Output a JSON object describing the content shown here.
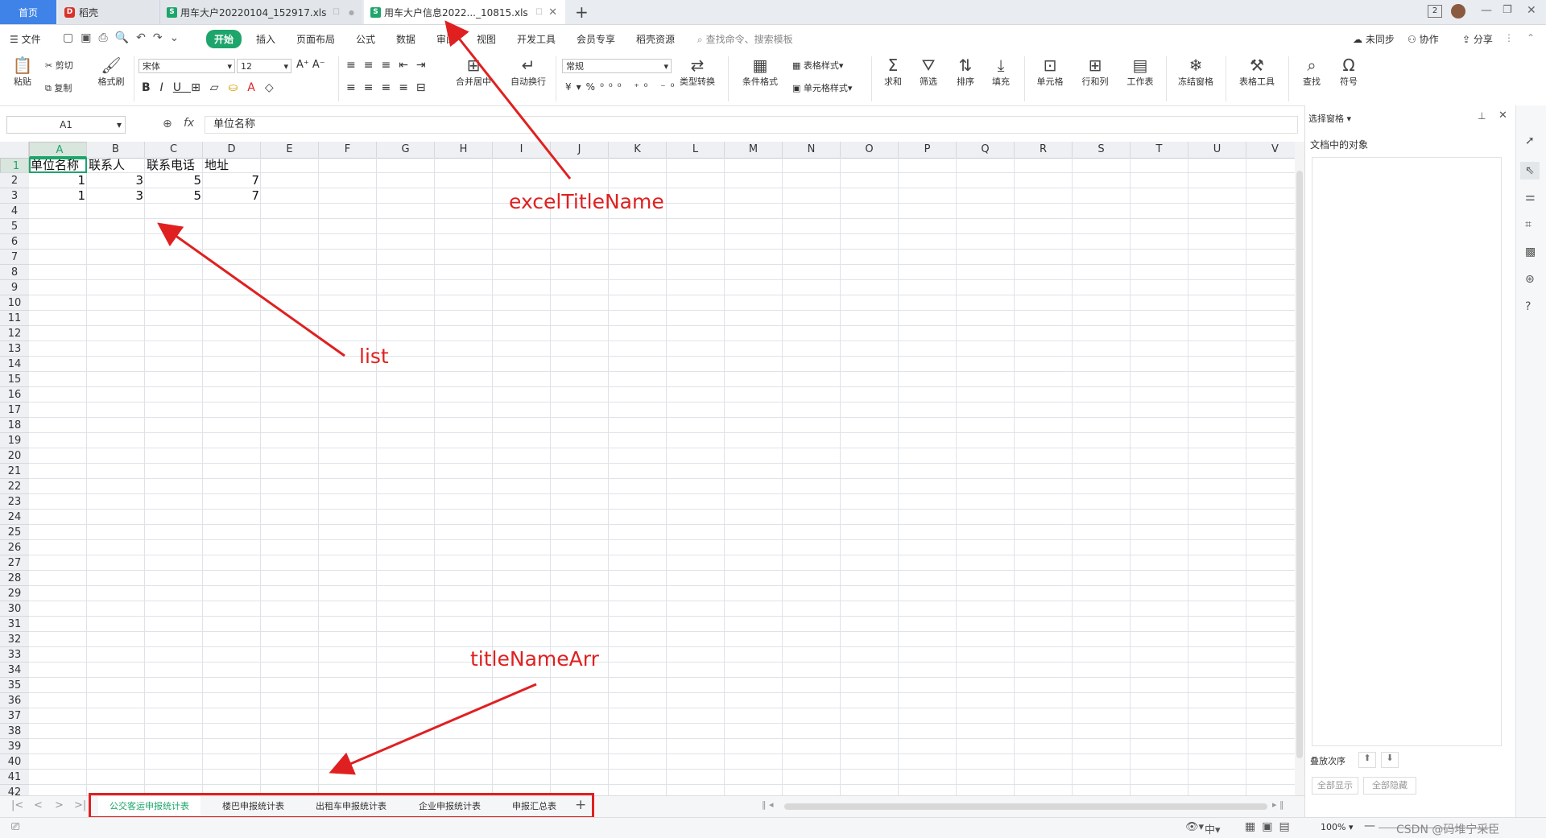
{
  "titlebar": {
    "home_tab": "首页",
    "tabs": [
      {
        "label": "稻壳",
        "icon": "docer-icon"
      },
      {
        "label": "用车大户20220104_152917.xls",
        "icon": "spreadsheet-icon"
      },
      {
        "label": "用车大户信息2022..._10815.xls",
        "icon": "spreadsheet-icon"
      }
    ],
    "new_tab": "+",
    "badge": "2"
  },
  "menubar": {
    "file": "文件",
    "items": [
      "开始",
      "插入",
      "页面布局",
      "公式",
      "数据",
      "审阅",
      "视图",
      "开发工具",
      "会员专享",
      "稻壳资源"
    ],
    "search_placeholder": "查找命令、搜索模板",
    "right": [
      "未同步",
      "协作",
      "分享"
    ]
  },
  "ribbon": {
    "paste": "粘贴",
    "cut": "剪切",
    "copy": "复制",
    "format_painter": "格式刷",
    "font_name": "宋体",
    "font_size": "12",
    "merge": "合并居中",
    "wrap": "自动换行",
    "number_format": "常规",
    "type_convert": "类型转换",
    "conditional": "条件格式",
    "table_style": "表格样式",
    "cell_style": "单元格样式",
    "sum": "求和",
    "filter": "筛选",
    "sort": "排序",
    "fill": "填充",
    "cell": "单元格",
    "rowcol": "行和列",
    "sheet": "工作表",
    "freeze": "冻结窗格",
    "table_tools": "表格工具",
    "find": "查找",
    "symbol": "符号",
    "currency": "¥",
    "percent": "%"
  },
  "formula": {
    "cell_ref": "A1",
    "fx": "fx",
    "value": "单位名称"
  },
  "grid": {
    "columns": [
      "A",
      "B",
      "C",
      "D",
      "E",
      "F",
      "G",
      "H",
      "I",
      "J",
      "K",
      "L",
      "M",
      "N",
      "O",
      "P",
      "Q",
      "R",
      "S",
      "T",
      "U",
      "V"
    ],
    "rows": [
      "1",
      "2",
      "3",
      "4",
      "5",
      "6",
      "7",
      "8",
      "9",
      "10",
      "11",
      "12",
      "13",
      "14",
      "15",
      "16",
      "17",
      "18",
      "19",
      "20",
      "21",
      "22",
      "23",
      "24",
      "25",
      "26",
      "27",
      "28",
      "29",
      "30",
      "31",
      "32",
      "33",
      "34",
      "35",
      "36",
      "37",
      "38",
      "39",
      "40",
      "41",
      "42"
    ],
    "cells": {
      "A1": "单位名称",
      "B1": "联系人",
      "C1": "联系电话",
      "D1": "地址",
      "A2": "1",
      "B2": "3",
      "C2": "5",
      "D2": "7",
      "A3": "1",
      "B3": "3",
      "C3": "5",
      "D3": "7"
    }
  },
  "sheets": [
    "公交客运申报统计表",
    "楼巴申报统计表",
    "出租车申报统计表",
    "企业申报统计表",
    "申报汇总表"
  ],
  "add_sheet": "+",
  "statusbar": {
    "ime": "中",
    "zoom": "100%",
    "watermark": "CSDN @码堆宁采臣"
  },
  "rightpanel": {
    "title": "选择窗格",
    "objects_label": "文档中的对象",
    "order_label": "叠放次序",
    "show_all": "全部显示",
    "hide_all": "全部隐藏"
  },
  "annotations": {
    "excel_title": "excelTitleName",
    "list": "list",
    "title_arr": "titleNameArr"
  },
  "colors": {
    "accent": "#1ea56b",
    "annotation": "#e02020",
    "home_tab": "#3f83e8"
  }
}
